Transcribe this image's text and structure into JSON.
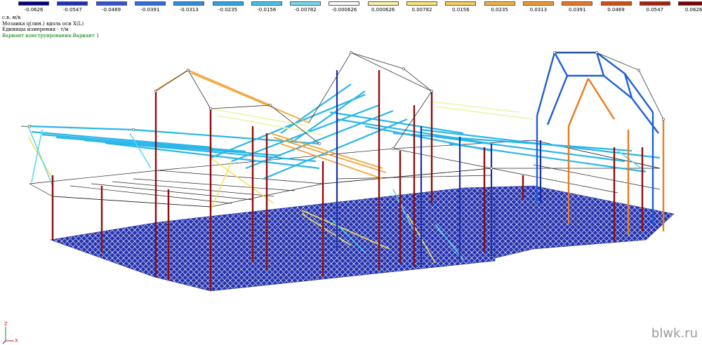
{
  "legend": {
    "ticks": [
      "-0.0626",
      "-0.0547",
      "-0.0469",
      "-0.0391",
      "-0.0313",
      "-0.0235",
      "-0.0156",
      "-0.00782",
      "-0.000626",
      "0.000626",
      "0.00782",
      "0.0156",
      "0.0235",
      "0.0313",
      "0.0391",
      "0.0469",
      "0.0547",
      "0.0626"
    ],
    "colors": [
      "#000080",
      "#1c2fbf",
      "#3050e0",
      "#2a6ee6",
      "#2c8ee6",
      "#29a8e8",
      "#40c4ee",
      "#70dcf2",
      "#ffffff",
      "#fff5a8",
      "#fbe676",
      "#f8d05a",
      "#f4b440",
      "#f39a2c",
      "#ee761c",
      "#d84c10",
      "#b01e0a",
      "#800000"
    ]
  },
  "info": {
    "line1": "с.в. м/к",
    "line2": "Мозаика q(лин.) вдоль оси  X(L)",
    "line3": "Единицы измерения - т/м",
    "line4": "Вариант конструирования:Вариант 1"
  },
  "axis": {
    "z_label": "Z",
    "x_label": "X"
  },
  "watermark": "blwk.ru"
}
